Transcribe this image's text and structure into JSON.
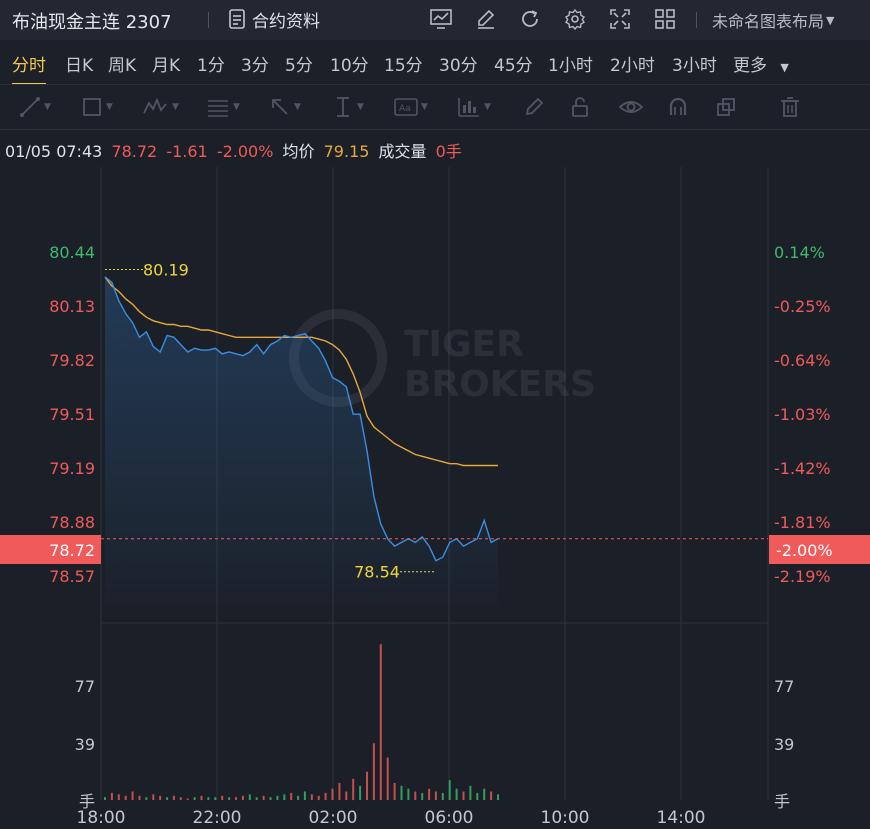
{
  "header": {
    "title": "布油现金主连 2307",
    "contract_info": "合约资料",
    "layout_name": "未命名图表布局",
    "tool_icons": [
      "chart-settings-icon",
      "edit-icon",
      "refresh-icon",
      "gear-icon",
      "fullscreen-icon",
      "grid-layout-icon"
    ]
  },
  "periods": {
    "items": [
      "分时",
      "日K",
      "周K",
      "月K",
      "1分",
      "3分",
      "5分",
      "10分",
      "15分",
      "30分",
      "45分",
      "1小时",
      "2小时",
      "3小时",
      "更多"
    ],
    "active": "分时"
  },
  "drawing_tools": [
    "line-tool-icon",
    "rectangle-tool-icon",
    "wave-tool-icon",
    "fibonacci-tool-icon",
    "arrow-tool-icon",
    "measure-tool-icon",
    "text-tool-icon",
    "indicator-tool-icon",
    "pencil-icon",
    "lock-icon",
    "eye-icon",
    "magnet-icon",
    "layers-icon",
    "trash-icon"
  ],
  "info_bar": {
    "datetime": "01/05 07:43",
    "price": "78.72",
    "change": "-1.61",
    "change_pct": "-2.00%",
    "avg_label": "均价",
    "avg_price": "79.15",
    "volume_label": "成交量",
    "volume": "0手"
  },
  "colors": {
    "up": "#3fba6f",
    "down": "#f05a5a",
    "price_line": "#3b8ee0",
    "avg_line": "#e8a83a",
    "marker": "#f0d43a",
    "current_tag": "#f15a5a"
  },
  "watermark": {
    "line1": "TIGER",
    "line2": "BROKERS"
  },
  "chart_data": {
    "type": "line",
    "x_ticks": [
      "18:00",
      "22:00",
      "02:00",
      "06:00",
      "10:00",
      "14:00"
    ],
    "price_axis": {
      "left_labels": [
        "80.44",
        "80.13",
        "79.82",
        "79.51",
        "79.19",
        "78.88",
        "78.57"
      ],
      "right_labels": [
        "0.14%",
        "-0.25%",
        "-0.64%",
        "-1.03%",
        "-1.42%",
        "-1.81%",
        "-2.19%"
      ],
      "current_price": "78.72",
      "current_pct": "-2.00%",
      "ylim": [
        78.26,
        80.75
      ]
    },
    "high_marker": "80.19",
    "low_marker": "78.54",
    "price_series": [
      80.15,
      80.12,
      80.02,
      79.95,
      79.9,
      79.82,
      79.85,
      79.77,
      79.74,
      79.83,
      79.82,
      79.78,
      79.74,
      79.76,
      79.75,
      79.75,
      79.76,
      79.73,
      79.74,
      79.73,
      79.72,
      79.74,
      79.78,
      79.73,
      79.78,
      79.8,
      79.83,
      79.82,
      79.83,
      79.84,
      79.8,
      79.76,
      79.69,
      79.6,
      79.58,
      79.55,
      79.4,
      79.4,
      79.2,
      78.95,
      78.8,
      78.72,
      78.68,
      78.7,
      78.72,
      78.7,
      78.73,
      78.68,
      78.6,
      78.62,
      78.7,
      78.72,
      78.68,
      78.7,
      78.72,
      78.82,
      78.7,
      78.72
    ],
    "avg_series": [
      80.15,
      80.1,
      80.07,
      80.03,
      80.0,
      79.96,
      79.93,
      79.91,
      79.9,
      79.89,
      79.89,
      79.88,
      79.88,
      79.87,
      79.86,
      79.86,
      79.85,
      79.84,
      79.83,
      79.82,
      79.82,
      79.82,
      79.82,
      79.82,
      79.82,
      79.82,
      79.82,
      79.82,
      79.82,
      79.82,
      79.82,
      79.81,
      79.8,
      79.78,
      79.75,
      79.7,
      79.62,
      79.52,
      79.39,
      79.33,
      79.3,
      79.27,
      79.24,
      79.22,
      79.2,
      79.18,
      79.17,
      79.16,
      79.15,
      79.14,
      79.13,
      79.13,
      79.12,
      79.12,
      79.12,
      79.12,
      79.12,
      79.12
    ],
    "volume_axis": {
      "labels": [
        "77",
        "39"
      ],
      "unit": "手",
      "ylim": [
        0,
        120
      ]
    },
    "volume_series": [
      2,
      5,
      4,
      3,
      6,
      3,
      2,
      4,
      3,
      2,
      3,
      2,
      1,
      2,
      3,
      2,
      2,
      3,
      2,
      2,
      3,
      4,
      2,
      3,
      2,
      3,
      4,
      5,
      3,
      6,
      4,
      3,
      5,
      8,
      12,
      6,
      15,
      10,
      20,
      40,
      110,
      30,
      12,
      10,
      8,
      6,
      5,
      8,
      6,
      5,
      14,
      8,
      6,
      10,
      5,
      8,
      6,
      4
    ]
  }
}
